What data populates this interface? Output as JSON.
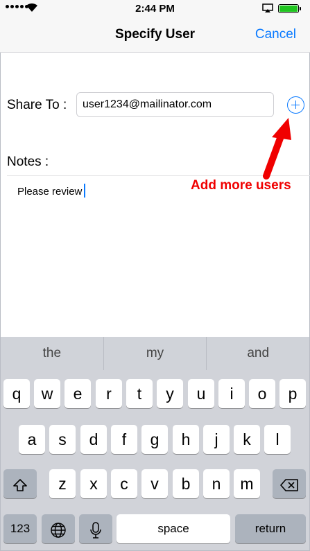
{
  "status_bar": {
    "time": "2:44 PM",
    "battery_level": 1.0
  },
  "nav": {
    "title": "Specify User",
    "cancel_label": "Cancel"
  },
  "form": {
    "share_to_label": "Share To :",
    "share_to_value": "user1234@mailinator.com",
    "notes_label": "Notes :",
    "notes_value": "Please review",
    "add_icon": "plus-circle-icon"
  },
  "annotation": {
    "text": "Add more users",
    "color": "#f00000"
  },
  "keyboard": {
    "suggestions": [
      "the",
      "my",
      "and"
    ],
    "row1": [
      "q",
      "w",
      "e",
      "r",
      "t",
      "y",
      "u",
      "i",
      "o",
      "p"
    ],
    "row2": [
      "a",
      "s",
      "d",
      "f",
      "g",
      "h",
      "j",
      "k",
      "l"
    ],
    "row3": [
      "z",
      "x",
      "c",
      "v",
      "b",
      "n",
      "m"
    ],
    "numbers_key": "123",
    "space_key": "space",
    "return_key": "return"
  },
  "colors": {
    "accent": "#0a7aff",
    "battery": "#1fc51f"
  }
}
